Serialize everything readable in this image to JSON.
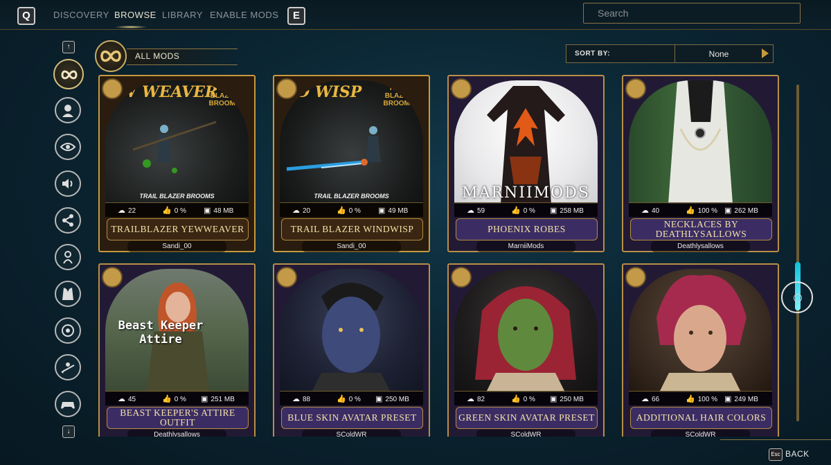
{
  "topbar": {
    "left_key": "Q",
    "right_key": "E",
    "tabs": [
      {
        "label": "DISCOVERY"
      },
      {
        "label": "BROWSE"
      },
      {
        "label": "LIBRARY"
      },
      {
        "label": "ENABLE MODS"
      }
    ],
    "active_tab": "BROWSE",
    "search_placeholder": "Search"
  },
  "filter": {
    "category_label": "ALL MODS",
    "sort_label": "SORT BY:",
    "sort_value": "None"
  },
  "sidebar": {
    "categories": [
      {
        "icon": "infinity-icon",
        "active": true
      },
      {
        "icon": "head-icon"
      },
      {
        "icon": "eye-icon"
      },
      {
        "icon": "speaker-icon"
      },
      {
        "icon": "node-tree-icon"
      },
      {
        "icon": "person-bust-icon"
      },
      {
        "icon": "outfit-icon"
      },
      {
        "icon": "target-icon"
      },
      {
        "icon": "broom-rider-icon"
      },
      {
        "icon": "gamepad-icon"
      }
    ],
    "up_key": "↑",
    "down_key": "↓"
  },
  "cards": [
    {
      "title": "TRAILBLAZER YEWWEAVER",
      "author": "Sandi_00",
      "downloads": "22",
      "rating": "0 %",
      "size": "48 MB",
      "overlay": "EW WEAVER",
      "brand": "TRAIL BLAZER BROOMS",
      "caption": "TRAIL BLAZER BROOMS",
      "type_icon": "broom-icon",
      "theme": "gold"
    },
    {
      "title": "TRAIL BLAZER WINDWISP",
      "author": "Sandi_00",
      "downloads": "20",
      "rating": "0 %",
      "size": "49 MB",
      "overlay": "ND WISP",
      "brand": "TRAIL BLAZER BROOMS",
      "caption": "TRAIL BLAZER BROOMS",
      "type_icon": "broom-icon",
      "theme": "gold"
    },
    {
      "title": "PHOENIX ROBES",
      "author": "MarniiMods",
      "downloads": "59",
      "rating": "0 %",
      "size": "258 MB",
      "overlay": "MARNIIMODS",
      "type_icon": "outfit-icon",
      "theme": "purple"
    },
    {
      "title": "NECKLACES BY DEATHLYSALLOWS",
      "author": "Deathlysallows",
      "downloads": "40",
      "rating": "100 %",
      "size": "262 MB",
      "type_icon": "outfit-icon",
      "theme": "purple"
    },
    {
      "title": "BEAST KEEPER'S ATTIRE OUTFIT",
      "author": "Deathlysallows",
      "downloads": "45",
      "rating": "0 %",
      "size": "251 MB",
      "overlay": "Beast Keeper Attire",
      "type_icon": "outfit-icon",
      "theme": "purple"
    },
    {
      "title": "BLUE SKIN AVATAR PRESET",
      "author": "SColdWR",
      "downloads": "88",
      "rating": "0 %",
      "size": "250 MB",
      "type_icon": "head-icon",
      "theme": "purple"
    },
    {
      "title": "GREEN SKIN AVATAR PRESET",
      "author": "SColdWR",
      "downloads": "82",
      "rating": "0 %",
      "size": "250 MB",
      "type_icon": "head-icon",
      "theme": "purple"
    },
    {
      "title": "ADDITIONAL HAIR COLORS",
      "author": "SColdWR",
      "downloads": "66",
      "rating": "100 %",
      "size": "249 MB",
      "type_icon": "outfit-icon",
      "theme": "purple"
    }
  ],
  "footer": {
    "esc_key": "Esc",
    "back_label": "BACK"
  },
  "colors": {
    "accent_gold": "#c79a3d",
    "card_purple": "#3b2d64",
    "scroll_cyan": "#0ec0d8"
  }
}
